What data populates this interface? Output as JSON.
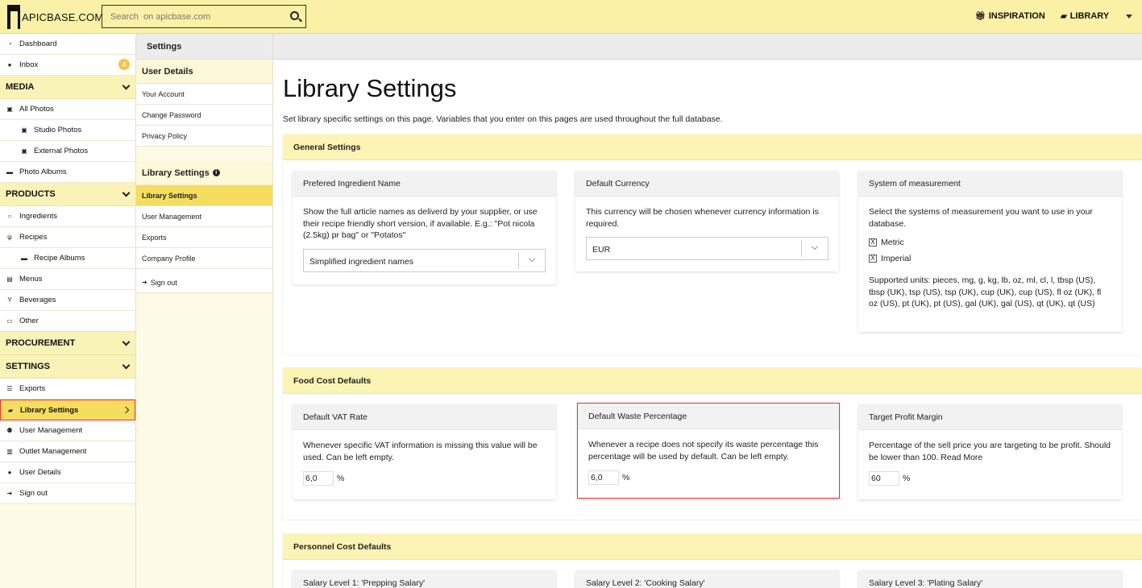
{
  "header": {
    "logo_text": "APICBASE.COM",
    "search_placeholder": "Search  on apicbase.com",
    "inspiration_label": "INSPIRATION",
    "library_label": "LIBRARY"
  },
  "sidebar": {
    "dashboard": "Dashboard",
    "inbox": "Inbox",
    "inbox_count": "4",
    "media": "MEDIA",
    "all_photos": "All Photos",
    "studio_photos": "Studio Photos",
    "external_photos": "External Photos",
    "photo_albums": "Photo Albums",
    "products": "PRODUCTS",
    "ingredients": "Ingredients",
    "recipes": "Recipes",
    "recipe_albums": "Recipe Albums",
    "menus": "Menus",
    "beverages": "Beverages",
    "other": "Other",
    "procurement": "PROCUREMENT",
    "settings": "SETTINGS",
    "exports": "Exports",
    "library_settings": "Library Settings",
    "user_management": "User Management",
    "outlet_management": "Outlet Management",
    "user_details": "User Details",
    "sign_out": "Sign out"
  },
  "sidebar2": {
    "header": "Settings",
    "user_details_title": "User Details",
    "your_account": "Your Account",
    "change_password": "Change Password",
    "privacy_policy": "Privacy Policy",
    "library_settings_title": "Library Settings",
    "library_settings": "Library Settings",
    "user_management": "User Management",
    "exports": "Exports",
    "company_profile": "Company Profile",
    "sign_out": "Sign out"
  },
  "main": {
    "title": "Library Settings",
    "description": "Set library specific settings on this page. Variables that you enter on this pages are used throughout the full database.",
    "general": {
      "title": "General Settings",
      "ingredient_name": {
        "title": "Prefered Ingredient Name",
        "text": "Show the full article names as deliverd by your supplier, or use their recipe friendly short version, if available. E.g.: \"Pot nicola (2.5kg) pr bag\" or \"Potatos\"",
        "value": "Simplified ingredient names"
      },
      "currency": {
        "title": "Default Currency",
        "text": "This currency will be chosen whenever currency information is required.",
        "value": "EUR"
      },
      "measurement": {
        "title": "System of measurement",
        "text": "Select the systems of measurement you want to use in your database.",
        "metric": "Metric",
        "imperial": "Imperial",
        "check_mark": "X",
        "units": "Supported units: pieces, mg, g, kg, lb, oz, ml, cl, l, tbsp (US), tbsp (UK), tsp (US), tsp (UK), cup (UK), cup (US), fl oz (UK), fl oz (US), pt (UK), pt (US), gal (UK), gal (US), qt (UK), qt (US)"
      }
    },
    "food_cost": {
      "title": "Food Cost Defaults",
      "vat": {
        "title": "Default VAT Rate",
        "text": "Whenever specific VAT information is missing this value will be used. Can be left empty.",
        "value": "6,0",
        "unit": "%"
      },
      "waste": {
        "title": "Default Waste Percentage",
        "text": "Whenever a recipe does not specify its waste percentage this percentage will be used by default. Can be left empty.",
        "value": "6,0",
        "unit": "%"
      },
      "profit": {
        "title": "Target Profit Margin",
        "text": "Percentage of the sell price you are targeting to be profit. Should be lower than 100. Read More",
        "value": "60",
        "unit": "%"
      }
    },
    "personnel": {
      "title": "Personnel Cost Defaults",
      "level1": "Salary Level 1: 'Prepping Salary'",
      "level2": "Salary Level 2: 'Cooking Salary'",
      "level3": "Salary Level 3: 'Plating Salary'"
    }
  },
  "colors": {
    "accent": "#faf1a6",
    "active": "#f5dd5f",
    "highlight_border": "#ee3333"
  }
}
